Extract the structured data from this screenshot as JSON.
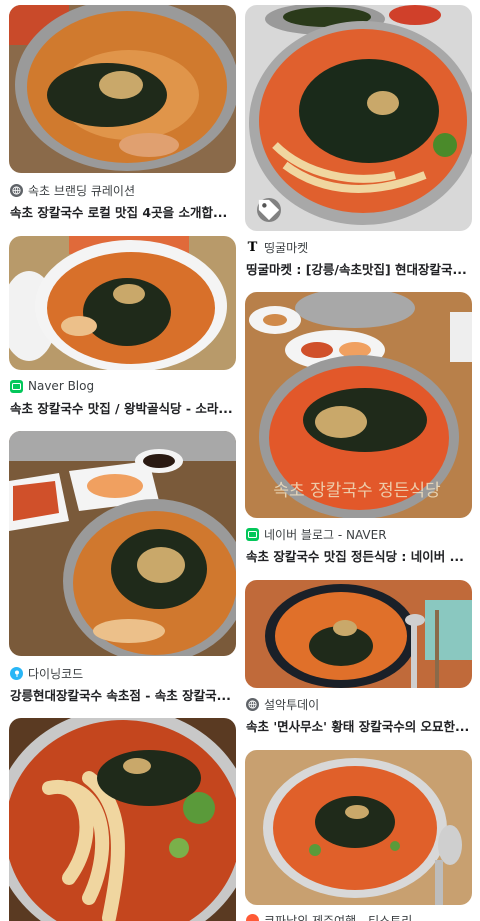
{
  "results": [
    {
      "source": "속초 브랜딩 큐레이션",
      "title": "속초 장칼국수 로컬 맛집 4곳을 소개합...",
      "favicon": "globe-icon",
      "favicon_color": "#5f6368"
    },
    {
      "source": "띵굴마켓",
      "title": "띵굴마켓 : [강릉/속초맛집] 현대장칼국...",
      "favicon": "letter-t-icon",
      "favicon_color": "#000000"
    },
    {
      "source": "Naver Blog",
      "title": "속초 장칼국수 맛집 / 왕박골식당 - 소라...",
      "favicon": "naver-blog-icon",
      "favicon_color": "#03c75a"
    },
    {
      "source": "네이버 블로그 - NAVER",
      "title": "속초 장칼국수 맛집 정든식당 : 네이버 ...",
      "favicon": "naver-blog-icon",
      "favicon_color": "#03c75a",
      "watermark": "속초 장칼국수 정든식당"
    },
    {
      "source": "다이닝코드",
      "title": "강릉현대장칼국수 속초점 - 속초 장칼국...",
      "favicon": "diningcode-icon",
      "favicon_color": "#29b6f6"
    },
    {
      "source": "설악투데이",
      "title": "속초 '면사무소' 황태 장칼국수의 오묘한...",
      "favicon": "globe-icon",
      "favicon_color": "#5f6368"
    },
    {
      "source": "",
      "title": "",
      "favicon": "",
      "favicon_color": "#ff5a36"
    },
    {
      "source": "코파남의 제주여행 - 티스토리",
      "title": "",
      "favicon": "tistory-icon",
      "favicon_color": "#ff5a36"
    }
  ]
}
